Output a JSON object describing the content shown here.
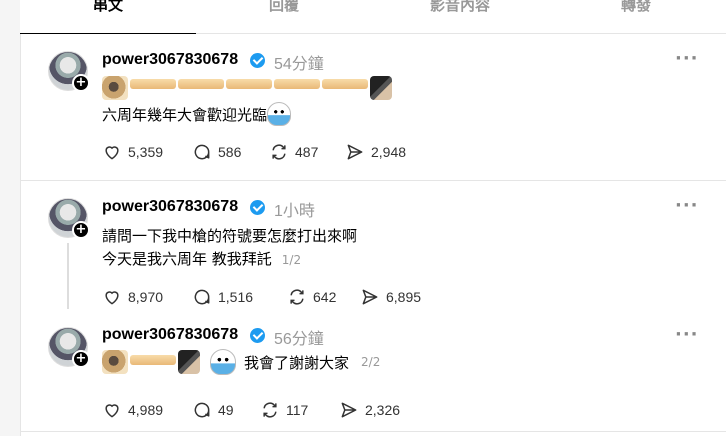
{
  "tabs": [
    {
      "label": "串文",
      "active": true
    },
    {
      "label": "回覆",
      "active": false
    },
    {
      "label": "影音內容",
      "active": false
    },
    {
      "label": "轉發",
      "active": false
    }
  ],
  "posts": [
    {
      "username": "power3067830678",
      "time": "54分鐘",
      "stickers": [
        "pug-face",
        "stick",
        "stick",
        "stick",
        "stick",
        "stick",
        "hand"
      ],
      "text": "六周年幾年大會歡迎光臨",
      "trailing_sticker": "crying-ghost",
      "stats": {
        "likes": "5,359",
        "replies": "586",
        "reposts": "487",
        "shares": "2,948"
      }
    },
    {
      "username": "power3067830678",
      "time": "1小時",
      "text_line1": "請問一下我中槍的符號要怎麼打出來啊",
      "text_line2": "今天是我六周年 教我拜託",
      "pager": "1/2",
      "stats": {
        "likes": "8,970",
        "replies": "1,516",
        "reposts": "642",
        "shares": "6,895"
      }
    },
    {
      "username": "power3067830678",
      "time": "56分鐘",
      "stickers": [
        "pug-face",
        "stick",
        "hand",
        "crying-ghost"
      ],
      "text": "我會了謝謝大家",
      "pager": "2/2",
      "stats": {
        "likes": "4,989",
        "replies": "49",
        "reposts": "117",
        "shares": "2,326"
      }
    }
  ],
  "icons": {
    "more": "more-dots-icon",
    "like": "heart-icon",
    "reply": "comment-icon",
    "repost": "repost-icon",
    "share": "send-icon",
    "verified": "verified-badge-icon"
  },
  "colors": {
    "verified": "#1d9bf0",
    "muted": "#999999"
  }
}
